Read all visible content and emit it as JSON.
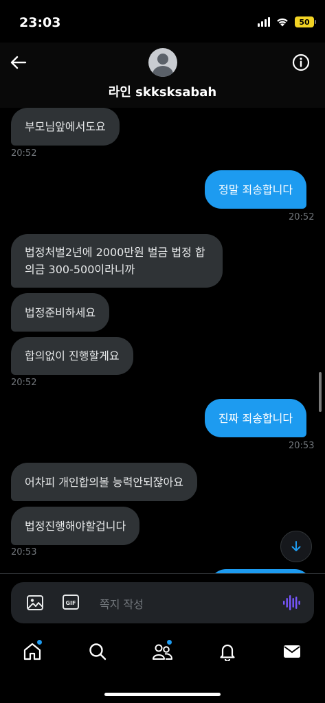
{
  "status_bar": {
    "time": "23:03",
    "battery": "50"
  },
  "header": {
    "contact_name": "라인 skksksabah"
  },
  "messages": [
    {
      "dir": "in",
      "text": "부모님앞에서도요"
    },
    {
      "time": "20:52"
    },
    {
      "dir": "out",
      "text": "정말 죄송합니다"
    },
    {
      "time": "20:52"
    },
    {
      "dir": "in",
      "text": "법정처벌2년에 2000만원 벌금 법정 합의금 300-500이라니까"
    },
    {
      "dir": "in",
      "text": "법정준비하세요"
    },
    {
      "dir": "in",
      "text": "합의없이 진행할게요"
    },
    {
      "time": "20:52"
    },
    {
      "dir": "out",
      "text": "진짜 죄송합니다"
    },
    {
      "time": "20:53"
    },
    {
      "dir": "in",
      "text": "어차피 개인합의볼 능력안되잖아요"
    },
    {
      "dir": "in",
      "text": "법정진행해야할겁니다"
    },
    {
      "time": "20:53"
    }
  ],
  "compose": {
    "placeholder": "쪽지 작성",
    "gif_label": "GIF"
  },
  "tabs": [
    {
      "icon": "home-icon",
      "badge": true
    },
    {
      "icon": "search-icon",
      "badge": false
    },
    {
      "icon": "communities-icon",
      "badge": true
    },
    {
      "icon": "notifications-icon",
      "badge": false
    },
    {
      "icon": "messages-icon",
      "badge": false
    }
  ],
  "colors": {
    "accent": "#1d9bf0",
    "incoming_bubble": "#2f3336",
    "background": "#000000",
    "muted": "#71767b"
  }
}
